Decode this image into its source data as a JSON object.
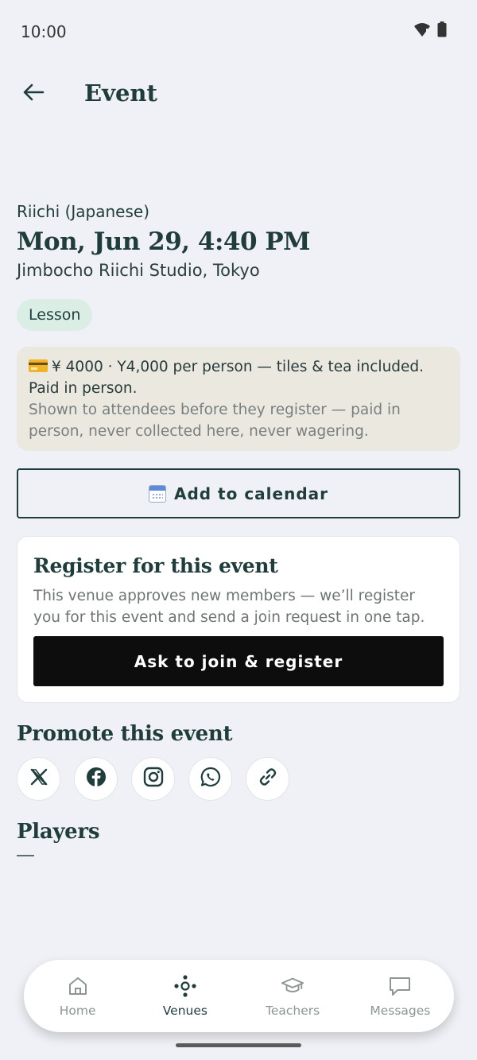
{
  "status_bar": {
    "time": "10:00"
  },
  "app_bar": {
    "title": "Event"
  },
  "event": {
    "game_type": "Riichi (Japanese)",
    "date": "Mon, Jun 29, 4:40 PM",
    "venue": "Jimbocho Riichi Studio, Tokyo",
    "tag": "Lesson",
    "price_line": "¥ 4000 · Y4,000 per person — tiles & tea included. Paid in person.",
    "price_note": "Shown to attendees before they register — paid in person, never collected here, never wagering."
  },
  "calendar_button": {
    "label": "Add to calendar"
  },
  "register": {
    "title": "Register for this event",
    "description": "This venue approves new members — we’ll register you for this event and send a join request in one tap.",
    "button_label": "Ask to join & register"
  },
  "promote": {
    "title": "Promote this event",
    "share_targets": [
      "x-icon",
      "facebook-icon",
      "instagram-icon",
      "whatsapp-icon",
      "link-icon"
    ]
  },
  "players": {
    "title": "Players",
    "empty_value": "—"
  },
  "bottom_nav": {
    "items": [
      {
        "label": "Home",
        "icon": "home-icon",
        "active": false
      },
      {
        "label": "Venues",
        "icon": "venues-icon",
        "active": true
      },
      {
        "label": "Teachers",
        "icon": "graduation-cap-icon",
        "active": false
      },
      {
        "label": "Messages",
        "icon": "chat-icon",
        "active": false
      }
    ]
  },
  "colors": {
    "background": "#eff1f6",
    "primary": "#1f3d3b",
    "tag_bg": "#dbeee6",
    "price_bg": "#ebe8e0",
    "join_button_bg": "#0d0d0d"
  }
}
